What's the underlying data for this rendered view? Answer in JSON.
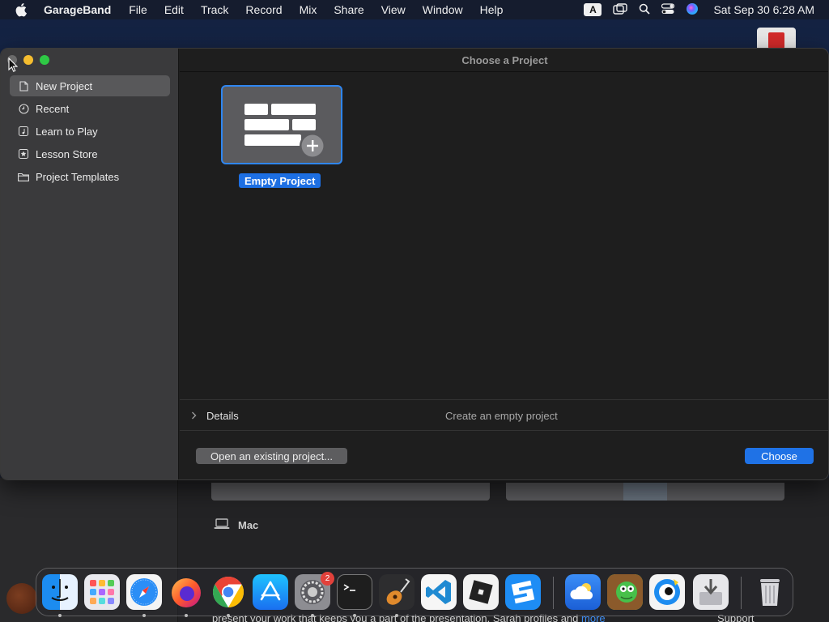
{
  "menubar": {
    "app_name": "GarageBand",
    "items": [
      "File",
      "Edit",
      "Track",
      "Record",
      "Mix",
      "Share",
      "View",
      "Window",
      "Help"
    ],
    "input_source": "A",
    "clock": "Sat Sep 30  6:28 AM"
  },
  "dialog": {
    "title": "Choose a Project",
    "sidebar": [
      {
        "label": "New Project",
        "icon": "document-icon",
        "selected": true
      },
      {
        "label": "Recent",
        "icon": "clock-icon",
        "selected": false
      },
      {
        "label": "Learn to Play",
        "icon": "music-note-icon",
        "selected": false
      },
      {
        "label": "Lesson Store",
        "icon": "star-icon",
        "selected": false
      },
      {
        "label": "Project Templates",
        "icon": "folder-icon",
        "selected": false
      }
    ],
    "project": {
      "label": "Empty Project"
    },
    "details": {
      "toggle_label": "Details",
      "description": "Create an empty project"
    },
    "buttons": {
      "open_existing": "Open an existing project...",
      "choose": "Choose"
    }
  },
  "background": {
    "mac_label": "Mac",
    "bottom_text": "present your work that keeps you a part of the presentation. Sarah profiles and",
    "bottom_link": "more",
    "support": "Support"
  },
  "dock": {
    "apps": [
      "Finder",
      "Launchpad",
      "Safari",
      "Firefox",
      "Chrome",
      "App Store",
      "System Settings",
      "Terminal",
      "GarageBand",
      "Visual Studio Code",
      "Roblox",
      "Roblox Studio",
      "Weather",
      "Where's My Water",
      "Proxyman",
      "Downloads",
      "Trash"
    ],
    "settings_badge": "2"
  },
  "colors": {
    "accent": "#1f72e6",
    "selection": "#2f86f0"
  }
}
